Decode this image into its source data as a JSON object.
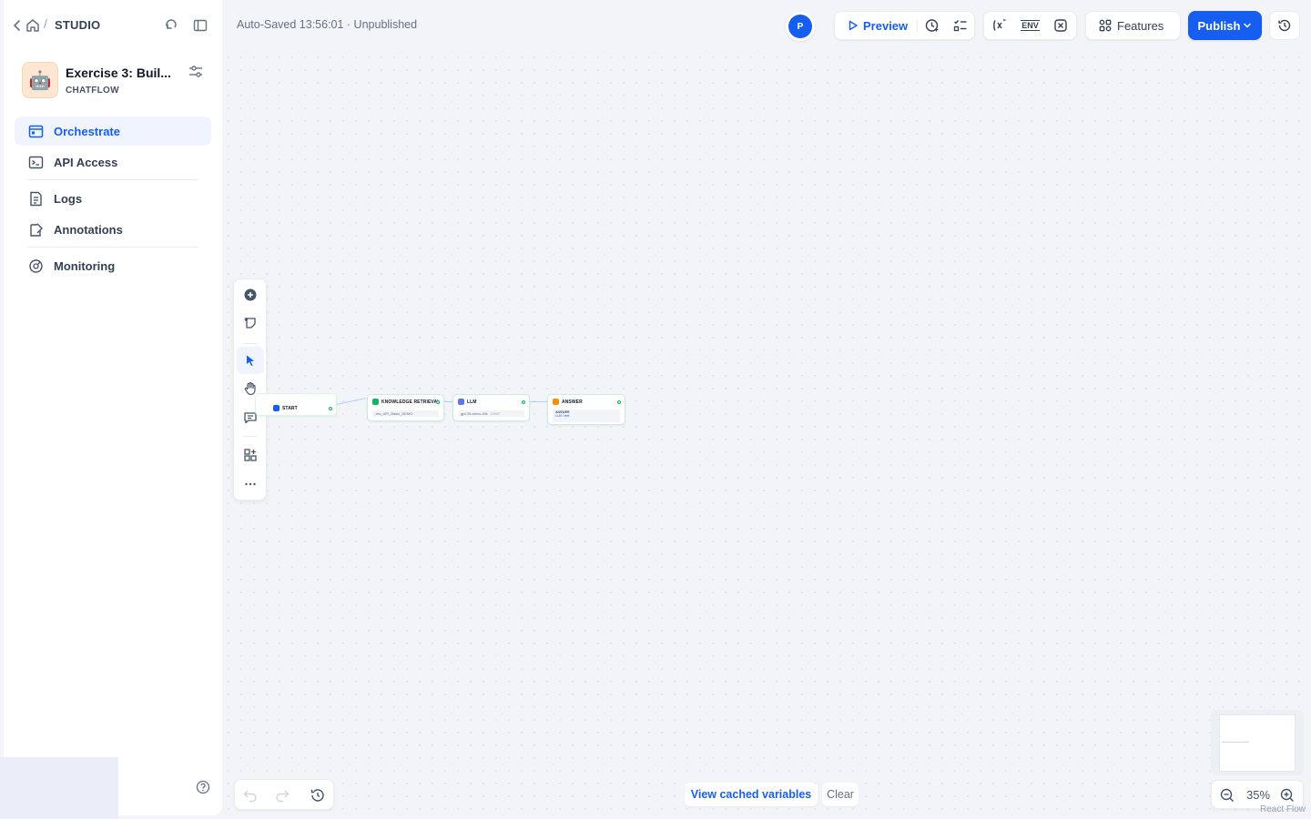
{
  "breadcrumb": {
    "section": "STUDIO"
  },
  "app": {
    "name": "Exercise 3: Buil...",
    "type": "CHATFLOW",
    "avatar": "🤖"
  },
  "nav": [
    {
      "label": "Orchestrate",
      "icon": "orchestrate-icon",
      "active": true
    },
    {
      "label": "API Access",
      "icon": "terminal-icon"
    },
    {
      "label": "Logs",
      "icon": "logs-icon"
    },
    {
      "label": "Annotations",
      "icon": "annotations-icon"
    },
    {
      "label": "Monitoring",
      "icon": "monitoring-icon"
    }
  ],
  "status": {
    "autosave": "Auto-Saved 13:56:01 · Unpublished"
  },
  "user": {
    "initial": "P"
  },
  "toolbar": {
    "preview_label": "Preview",
    "features_label": "Features",
    "publish_label": "Publish",
    "env_label": "ENV"
  },
  "workflow": {
    "nodes": [
      {
        "title": "START",
        "body": ""
      },
      {
        "title": "KNOWLEDGE RETRIEVAL",
        "body": "Jira_API_Basic_DEMO"
      },
      {
        "title": "LLM",
        "body": "gpt-35-turbo-16k",
        "tag": "CHAT"
      },
      {
        "title": "ANSWER",
        "body_label": "ANSWER",
        "body": "LLM / text"
      }
    ]
  },
  "bottom": {
    "cached_label": "View cached variables",
    "clear_label": "Clear",
    "zoom": "35%",
    "attribution": "React Flow"
  },
  "colors": {
    "accent": "#155eef",
    "success": "#12b76a"
  }
}
